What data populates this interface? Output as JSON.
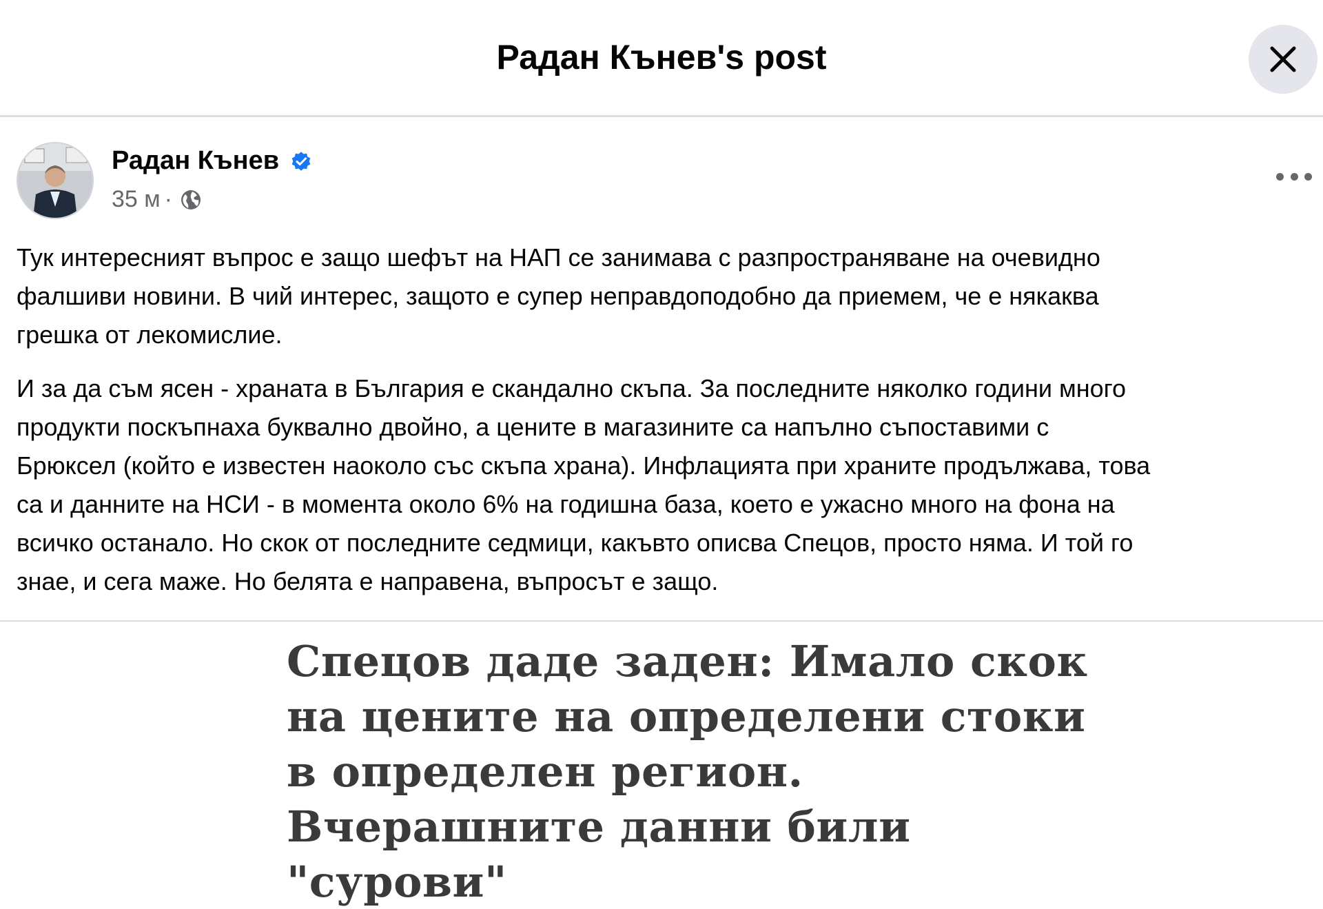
{
  "header": {
    "title": "Радан Кънев's post",
    "close_icon": "close-icon"
  },
  "post": {
    "author": "Радан Кънев",
    "verified_icon": "verified-badge-icon",
    "time": "35 м",
    "separator": "·",
    "privacy_icon": "globe-icon",
    "more_icon": "more-options-icon",
    "paragraphs": [
      "Тук интересният въпрос е защо шефът на НАП се занимава с разпространяване на очевидно\nфалшиви новини. В чий интерес, защото е супер неправдоподобно да приемем, че е някаква\nгрешка от лекомислие.",
      "И за да съм ясен - храната в България е скандално скъпа. За последните няколко години много\nпродукти поскъпнаха буквално двойно, а цените в магазините са напълно съпоставими с\nБрюксел (който е известен наоколо със скъпа храна). Инфлацията при храните продължава, това\nса и данните на НСИ - в момента около 6% на годишна база, което е ужасно много на фона на\nвсичко останало. Но скок от последните седмици, какъвто описва Спецов, просто няма. И той го\nзнае, и сега маже. Но белята е направена, въпросът е защо."
    ]
  },
  "attachment": {
    "headline": "Спецов даде заден: Имало скок\nна цените на определени стоки\nв определен регион.\nВчерашните данни били\n\"сурови\""
  },
  "colors": {
    "verified": "#1877f2",
    "secondary_text": "#65676b",
    "close_bg": "#e4e6eb",
    "headline": "#3a3a3a"
  }
}
